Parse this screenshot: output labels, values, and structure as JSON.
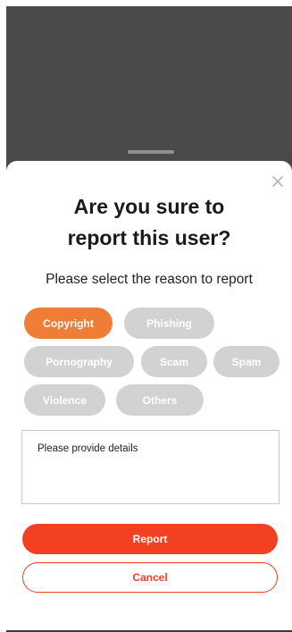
{
  "modal": {
    "title": "Are you sure to\nreport this user?",
    "subtitle": "Please select the reason to report",
    "close_icon": "close-icon"
  },
  "reasons": [
    {
      "label": "Copyright",
      "selected": true
    },
    {
      "label": "Phishing",
      "selected": false
    },
    {
      "label": "Pornography",
      "selected": false
    },
    {
      "label": "Scam",
      "selected": false
    },
    {
      "label": "Spam",
      "selected": false
    },
    {
      "label": "Violence",
      "selected": false
    },
    {
      "label": "Others",
      "selected": false
    }
  ],
  "details": {
    "value": "",
    "placeholder": "Please provide details"
  },
  "actions": {
    "report_label": "Report",
    "cancel_label": "Cancel"
  },
  "colors": {
    "accent": "#f33f22",
    "selected_chip": "#f07d35",
    "unselected_chip": "#d2d2d2",
    "backdrop": "#4a4a4a"
  }
}
